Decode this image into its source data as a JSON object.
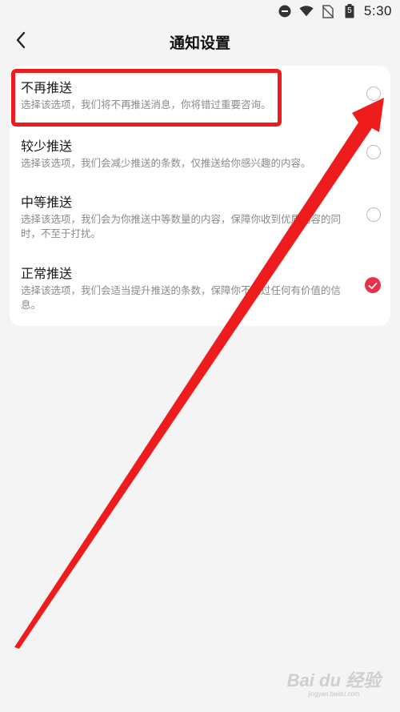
{
  "status_bar": {
    "time": "5:30",
    "icons": [
      "do-not-disturb-icon",
      "wifi-icon",
      "no-sim-icon",
      "battery-icon"
    ],
    "battery_level": "5"
  },
  "header": {
    "title": "通知设置",
    "back_icon": "chevron-left-icon"
  },
  "options": [
    {
      "title": "不再推送",
      "desc": "选择该选项，我们将不再推送消息，你将错过重要咨询。",
      "selected": false
    },
    {
      "title": "较少推送",
      "desc": "选择该选项，我们会减少推送的条数，仅推送给你感兴趣的内容。",
      "selected": false
    },
    {
      "title": "中等推送",
      "desc": "选择该选项，我们会为你推送中等数量的内容，保障你收到优质内容的同时，不至于打扰。",
      "selected": false
    },
    {
      "title": "正常推送",
      "desc": "选择该选项，我们会适当提升推送的条数，保障你不错过任何有价值的信息。",
      "selected": true
    }
  ],
  "colors": {
    "accent": "#e8324a",
    "annotation": "#ee1c1c"
  },
  "watermark": {
    "logo": "Bai du 经验",
    "url": "jingyan.baidu.com"
  }
}
